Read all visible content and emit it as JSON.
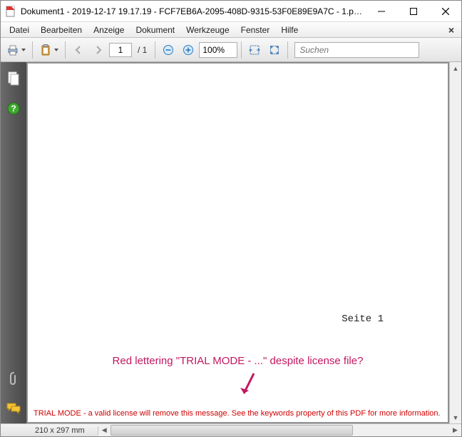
{
  "titlebar": {
    "title": "Dokument1 - 2019-12-17 19.17.19 - FCF7EB6A-2095-408D-9315-53F0E89E9A7C - 1.pdf - A..."
  },
  "menu": {
    "items": [
      "Datei",
      "Bearbeiten",
      "Anzeige",
      "Dokument",
      "Werkzeuge",
      "Fenster",
      "Hilfe"
    ]
  },
  "toolbar": {
    "page_current": "1",
    "page_total": "/ 1",
    "zoom": "100%",
    "search_placeholder": "Suchen"
  },
  "document": {
    "page_label": "Seite 1",
    "annotation_text": "Red lettering \"TRIAL MODE - ...\" despite license file?",
    "trial_message": "TRIAL MODE - a valid license will remove this message. See the keywords property of this PDF for more information."
  },
  "statusbar": {
    "dimensions": "210 x 297 mm"
  }
}
